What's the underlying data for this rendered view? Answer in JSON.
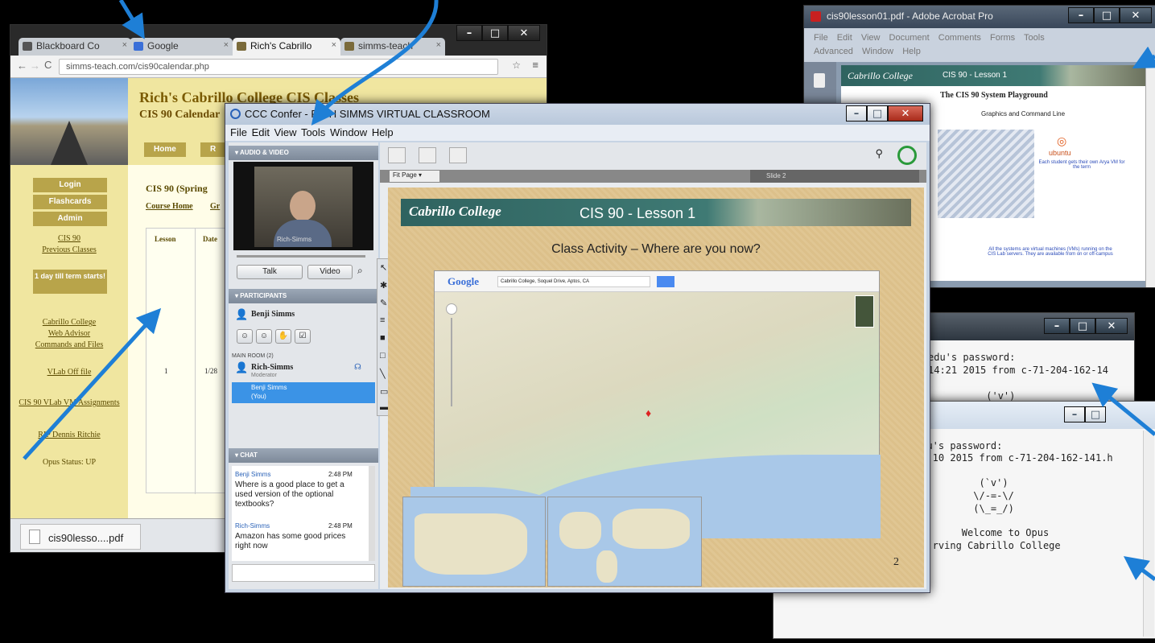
{
  "chrome": {
    "tabs": [
      {
        "label": "Blackboard Co"
      },
      {
        "label": "Google"
      },
      {
        "label": "Rich's Cabrillo"
      },
      {
        "label": "simms-teach"
      }
    ],
    "url": "simms-teach.com/cis90calendar.php",
    "site_title": "Rich's Cabrillo College CIS Classes",
    "site_subtitle": "CIS 90 Calendar",
    "nav": [
      "Home",
      "R"
    ],
    "side_buttons": [
      "Login",
      "Flashcards",
      "Admin"
    ],
    "side_links_top": [
      "CIS 90",
      "Previous Classes"
    ],
    "term_notice": "1 day till term starts!",
    "side_links": [
      "Cabrillo College",
      "Web Advisor",
      "Commands and Files",
      "VLab Off file",
      "CIS 90 VLab VM Assignments",
      "RIP Dennis Ritchie"
    ],
    "status": "Opus Status: UP",
    "heading": "CIS 90 (Spring",
    "links": [
      "Course Home",
      "Gr"
    ],
    "table_headers": [
      "Lesson",
      "Date"
    ],
    "row": [
      "1",
      "1/28"
    ],
    "download": "cis90lesso....pdf"
  },
  "acrobat": {
    "title": "cis90lesson01.pdf - Adobe Acrobat Pro",
    "menu": [
      "File",
      "Edit",
      "View",
      "Document",
      "Comments",
      "Forms",
      "Tools",
      "Advanced",
      "Window",
      "Help"
    ],
    "slide_banner": "CIS 90 - Lesson 1",
    "slide_title": "The CIS 90 System Playground",
    "sub": "Graphics and Command Line",
    "ubuntu": "ubuntu",
    "note1": "Each student gets their own Arya VM for the term",
    "note2": "All the systems are virtual machines (VMs) running on the CIS Lab servers. They are available from on or off-campus"
  },
  "terminal1": {
    "lines": [
      "edu's password:",
      "14:21 2015 from c-71-204-162-14",
      "",
      "          ('v')"
    ]
  },
  "terminal2": {
    "lines": [
      "edu's password:",
      "17:10 2015 from c-71-204-162-141.h",
      "",
      "           (`v')",
      "          \\/-=-\\/",
      "          (\\_=_/)",
      "",
      "        Welcome to Opus",
      "   rving Cabrillo College"
    ]
  },
  "ccc": {
    "title": "CCC Confer - RICH SIMMS VIRTUAL CLASSROOM",
    "menu": [
      "File",
      "Edit",
      "View",
      "Tools",
      "Window",
      "Help"
    ],
    "audio_header": "AUDIO & VIDEO",
    "video_label": "Rich-Simms",
    "talk": "Talk",
    "video": "Video",
    "participants_header": "PARTICIPANTS",
    "me": "Benji Simms",
    "main_room": "MAIN ROOM (2)",
    "moderator_name": "Rich-Simms",
    "moderator_role": "Moderator",
    "self_name": "Benji Simms",
    "self_role": "(You)",
    "chat_header": "CHAT",
    "chat": [
      {
        "who": "Benji Simms",
        "time": "2:48 PM",
        "msg": "Where is a good place to get a used version of the optional textbooks?"
      },
      {
        "who": "Rich-Simms",
        "time": "2:48 PM",
        "msg": "Amazon has some good prices right now"
      }
    ],
    "fit": "Fit Page",
    "slide_num_label": "Slide 2",
    "slide_logo": "Cabrillo College",
    "slide_banner": "CIS 90 - Lesson 1",
    "slide_heading": "Class Activity – Where are you now?",
    "map_brand": "Google",
    "map_search": "Cabrillo College, Soquel Drive, Aptos, CA",
    "page_number": "2"
  },
  "colors": {
    "arrow": "#1e7fd6",
    "banner_teal": "#2f6360",
    "chrome_yellow": "#f0e6a0"
  }
}
